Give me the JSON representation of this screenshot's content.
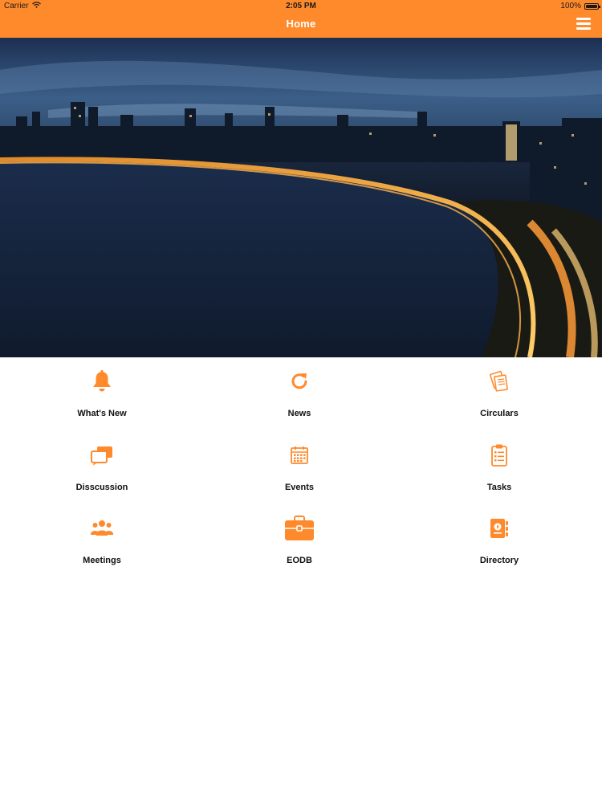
{
  "status_bar": {
    "carrier": "Carrier",
    "time": "2:05 PM",
    "battery": "100%",
    "battery_level": 1.0
  },
  "nav": {
    "title": "Home",
    "menu_icon": "hamburger-menu-icon"
  },
  "colors": {
    "accent": "#ff8a2c",
    "text": "#111111",
    "background": "#ffffff"
  },
  "menu": [
    {
      "label": "What's New",
      "icon": "bell-icon"
    },
    {
      "label": "News",
      "icon": "refresh-icon"
    },
    {
      "label": "Circulars",
      "icon": "documents-icon"
    },
    {
      "label": "Disscussion",
      "icon": "chat-bubbles-icon"
    },
    {
      "label": "Events",
      "icon": "calendar-icon"
    },
    {
      "label": "Tasks",
      "icon": "clipboard-icon"
    },
    {
      "label": "Meetings",
      "icon": "group-icon"
    },
    {
      "label": "EODB",
      "icon": "briefcase-icon"
    },
    {
      "label": "Directory",
      "icon": "address-book-icon"
    }
  ]
}
